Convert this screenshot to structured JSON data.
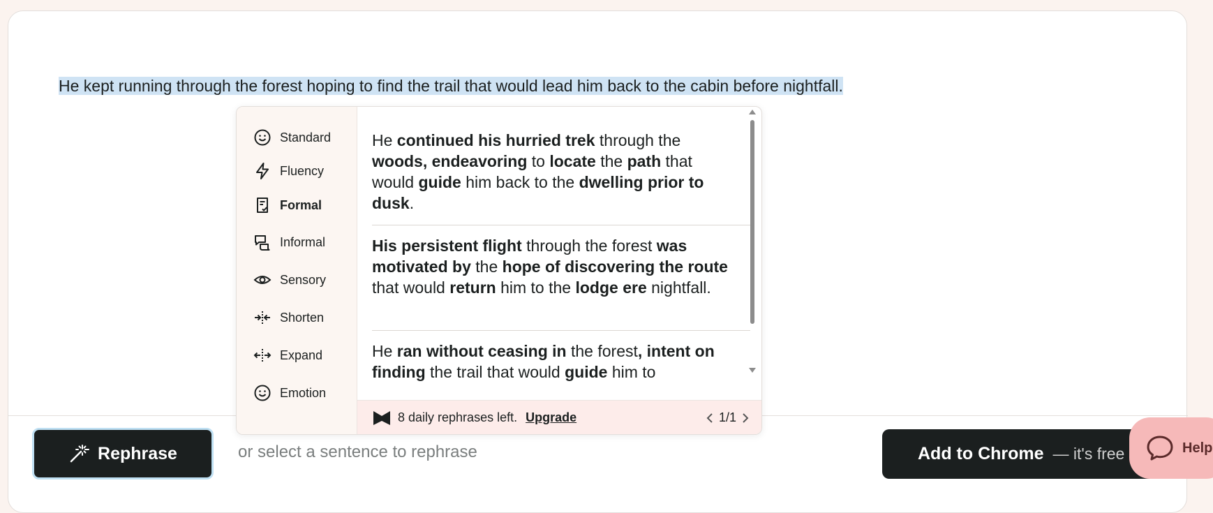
{
  "source_sentence": "He kept running through the forest hoping to find the trail that would lead him back to the cabin before nightfall.",
  "modes": [
    {
      "label": "Standard",
      "icon": "smile-icon"
    },
    {
      "label": "Fluency",
      "icon": "lightning-icon"
    },
    {
      "label": "Formal",
      "icon": "document-check-icon",
      "active": true
    },
    {
      "label": "Informal",
      "icon": "chat-bubbles-icon"
    },
    {
      "label": "Sensory",
      "icon": "eye-icon"
    },
    {
      "label": "Shorten",
      "icon": "shorten-arrows-icon"
    },
    {
      "label": "Expand",
      "icon": "expand-arrows-icon"
    },
    {
      "label": "Emotion",
      "icon": "smile-icon"
    }
  ],
  "results": [
    {
      "segments": [
        {
          "t": "He ",
          "b": false
        },
        {
          "t": "continued his hurried trek",
          "b": true
        },
        {
          "t": " through the ",
          "b": false
        },
        {
          "t": "woods, endeavoring",
          "b": true
        },
        {
          "t": " to ",
          "b": false
        },
        {
          "t": "locate",
          "b": true
        },
        {
          "t": " the ",
          "b": false
        },
        {
          "t": "path",
          "b": true
        },
        {
          "t": " that would ",
          "b": false
        },
        {
          "t": "guide",
          "b": true
        },
        {
          "t": " him back to the ",
          "b": false
        },
        {
          "t": "dwelling prior to dusk",
          "b": true
        },
        {
          "t": ".",
          "b": false
        }
      ]
    },
    {
      "segments": [
        {
          "t": "His persistent flight",
          "b": true
        },
        {
          "t": " through the forest ",
          "b": false
        },
        {
          "t": "was motivated by",
          "b": true
        },
        {
          "t": " the ",
          "b": false
        },
        {
          "t": "hope of discovering the route",
          "b": true
        },
        {
          "t": " that would ",
          "b": false
        },
        {
          "t": "return",
          "b": true
        },
        {
          "t": " him to the ",
          "b": false
        },
        {
          "t": "lodge ere",
          "b": true
        },
        {
          "t": " nightfall.",
          "b": false
        }
      ]
    },
    {
      "segments": [
        {
          "t": "He ",
          "b": false
        },
        {
          "t": "ran without ceasing in",
          "b": true
        },
        {
          "t": " the forest",
          "b": false
        },
        {
          "t": ", intent on finding",
          "b": true
        },
        {
          "t": " the trail that would ",
          "b": false
        },
        {
          "t": "guide",
          "b": true
        },
        {
          "t": " him to",
          "b": false
        }
      ]
    }
  ],
  "footer": {
    "remaining_text": "8 daily rephrases left.",
    "upgrade_label": "Upgrade",
    "page_indicator": "1/1"
  },
  "bottom_bar": {
    "rephrase_label": "Rephrase",
    "hint_text": "or select a sentence to rephrase",
    "chrome_label": "Add to Chrome",
    "chrome_sub": "— it's free",
    "help_label": "Help"
  }
}
